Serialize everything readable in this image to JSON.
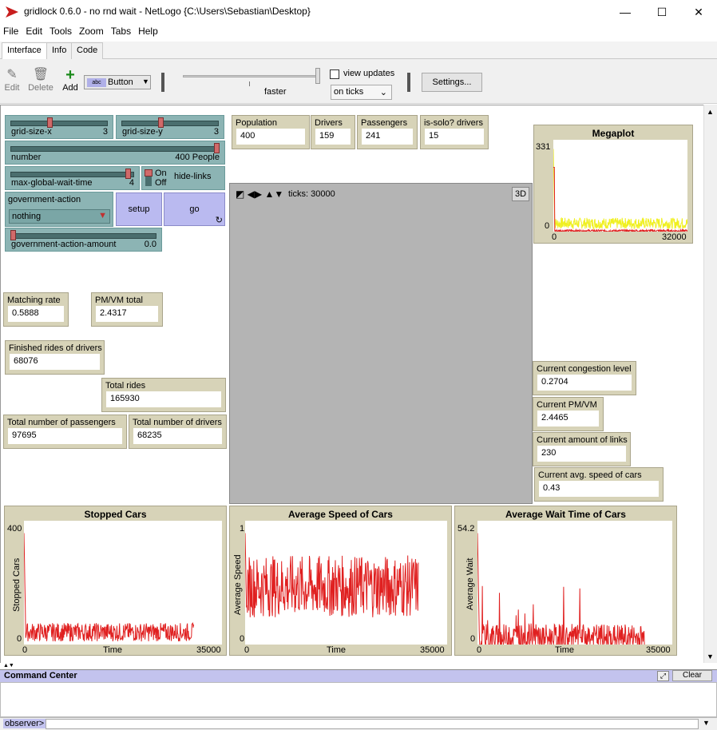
{
  "window": {
    "title": "gridlock 0.6.0 - no rnd wait - NetLogo {C:\\Users\\Sebastian\\Desktop}",
    "minimize": "—",
    "maximize": "☐",
    "close": "✕"
  },
  "menu": [
    "File",
    "Edit",
    "Tools",
    "Zoom",
    "Tabs",
    "Help"
  ],
  "tabs": [
    "Interface",
    "Info",
    "Code"
  ],
  "toolbar": {
    "edit": "Edit",
    "delete": "Delete",
    "add": "Add",
    "widget_type": "Button",
    "speed_label": "faster",
    "view_updates": "view updates",
    "update_mode": "on ticks",
    "settings": "Settings..."
  },
  "sliders": {
    "grid_x": {
      "label": "grid-size-x",
      "value": "3",
      "fraction": 0.4
    },
    "grid_y": {
      "label": "grid-size-y",
      "value": "3",
      "fraction": 0.4
    },
    "number": {
      "label": "number",
      "value": "400 People",
      "fraction": 1.0
    },
    "wait": {
      "label": "max-global-wait-time",
      "value": "4",
      "fraction": 0.97
    },
    "gov_amount": {
      "label": "government-action-amount",
      "value": "0.0",
      "fraction": 0.0
    }
  },
  "switch": {
    "on": "On",
    "off": "Off",
    "label": "hide-links"
  },
  "chooser": {
    "label": "government-action",
    "value": "nothing"
  },
  "buttons": {
    "setup": "setup",
    "go": "go"
  },
  "monitors": {
    "population": {
      "label": "Population",
      "value": "400"
    },
    "drivers": {
      "label": "Drivers",
      "value": "159"
    },
    "passengers": {
      "label": "Passengers",
      "value": "241"
    },
    "solo": {
      "label": "is-solo? drivers",
      "value": "15"
    },
    "matching": {
      "label": "Matching rate",
      "value": "0.5888"
    },
    "pmvm": {
      "label": "PM/VM total",
      "value": "2.4317"
    },
    "finished": {
      "label": "Finished rides of drivers",
      "value": "68076"
    },
    "total_rides": {
      "label": "Total rides",
      "value": "165930"
    },
    "total_pass": {
      "label": "Total number of passengers",
      "value": "97695"
    },
    "total_drivers": {
      "label": "Total number of drivers",
      "value": "68235"
    },
    "congestion": {
      "label": "Current congestion level",
      "value": "0.2704"
    },
    "cur_pmvm": {
      "label": "Current PM/VM",
      "value": "2.4465"
    },
    "links": {
      "label": "Current amount of links",
      "value": "230"
    },
    "speed": {
      "label": "Current avg. speed of cars",
      "value": "0.43"
    }
  },
  "view": {
    "ticks": "ticks: 30000",
    "btn3d": "3D"
  },
  "command_center": {
    "title": "Command Center",
    "clear": "Clear",
    "observer": "observer>"
  },
  "colors": {
    "slider": "#8cb4b4",
    "monitor": "#d7d3b8",
    "button": "#babaf0",
    "view": "#b4b4b4",
    "series_red": "#e02020",
    "series_yellow": "#f0f020"
  },
  "chart_data": [
    {
      "type": "line",
      "title": "Megaplot",
      "xlabel": "",
      "ylabel": "",
      "xlim": [
        0,
        32000
      ],
      "ylim": [
        0,
        331
      ],
      "xticks": [
        "0",
        "32000"
      ],
      "yticks": [
        "0",
        "331"
      ],
      "series": [
        {
          "color": "#f0f020",
          "level": 30,
          "spread": 20
        },
        {
          "color": "#e02020",
          "level": 3,
          "spread": 4
        }
      ],
      "x_end": 32000
    },
    {
      "type": "line",
      "title": "Stopped Cars",
      "xlabel": "Time",
      "ylabel": "Stopped Cars",
      "xlim": [
        0,
        35000
      ],
      "ylim": [
        0,
        400
      ],
      "xticks": [
        "0",
        "35000"
      ],
      "yticks": [
        "0",
        "400"
      ],
      "series": [
        {
          "color": "#e02020",
          "level": 40,
          "spread": 30
        }
      ],
      "x_end": 30000
    },
    {
      "type": "line",
      "title": "Average Speed of Cars",
      "xlabel": "Time",
      "ylabel": "Average Speed",
      "xlim": [
        0,
        35000
      ],
      "ylim": [
        0,
        1
      ],
      "xticks": [
        "0",
        "35000"
      ],
      "yticks": [
        "0",
        "1"
      ],
      "series": [
        {
          "color": "#e02020",
          "level": 0.47,
          "spread": 0.25
        }
      ],
      "x_end": 30000
    },
    {
      "type": "line",
      "title": "Average Wait Time of Cars",
      "xlabel": "Time",
      "ylabel": "Average Wait",
      "xlim": [
        0,
        35000
      ],
      "ylim": [
        0,
        54.2
      ],
      "xticks": [
        "0",
        "35000"
      ],
      "yticks": [
        "0",
        "54.2"
      ],
      "series": [
        {
          "color": "#e02020",
          "level": 3,
          "spread": 6
        }
      ],
      "x_end": 30000
    }
  ]
}
